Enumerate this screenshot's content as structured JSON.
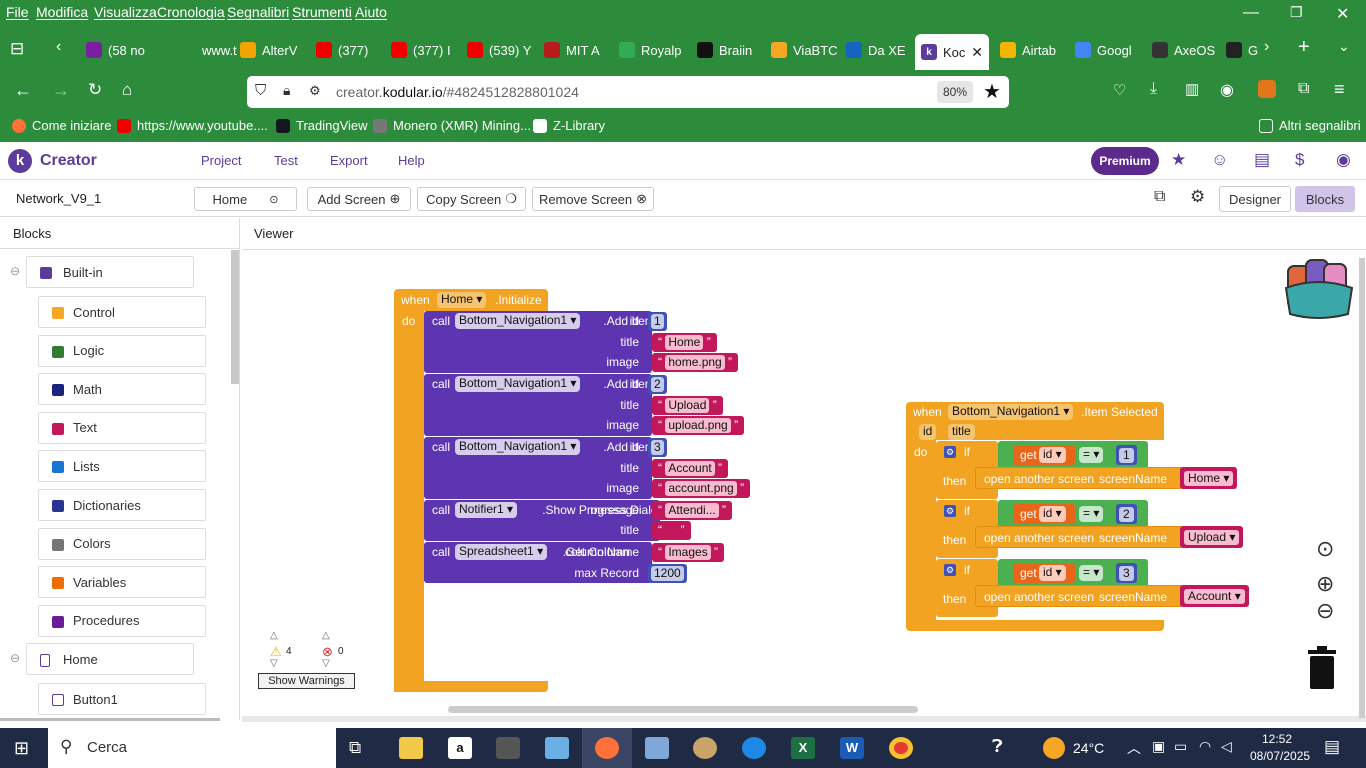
{
  "menu": [
    "File",
    "Modifica",
    "Visualizza",
    "Cronologia",
    "Segnalibri",
    "Strumenti",
    "Aiuto"
  ],
  "tabs": [
    {
      "label": "(58 no",
      "icon": "mail-icon",
      "color": "#7b1fa2"
    },
    {
      "label": "www.t",
      "icon": "globe-icon",
      "color": "#2d8c3c"
    },
    {
      "label": "AlterV",
      "icon": "amazon-icon",
      "color": "#f0a500"
    },
    {
      "label": "(377)",
      "icon": "youtube-icon",
      "color": "#e00"
    },
    {
      "label": "(377) I",
      "icon": "youtube-icon",
      "color": "#e00"
    },
    {
      "label": "(539) Y",
      "icon": "youtube-icon",
      "color": "#e00"
    },
    {
      "label": "MIT A",
      "icon": "mit-icon",
      "color": "#b71c1c"
    },
    {
      "label": "Royalp",
      "icon": "royal-icon",
      "color": "#3a5"
    },
    {
      "label": "Braiin",
      "icon": "braiins-icon",
      "color": "#111"
    },
    {
      "label": "ViaBTC",
      "icon": "viabtc-icon",
      "color": "#f5a623"
    },
    {
      "label": "Da XE",
      "icon": "xe-icon",
      "color": "#1565c0"
    },
    {
      "label": "Koc",
      "icon": "kodular-icon",
      "color": "#5c3c9b"
    },
    {
      "label": "Airtab",
      "icon": "airtable-icon",
      "color": "#f4b400"
    },
    {
      "label": "Googl",
      "icon": "google-icon",
      "color": "#4285f4"
    },
    {
      "label": "AxeOS",
      "icon": "axeos-icon",
      "color": "#333"
    },
    {
      "label": "G",
      "icon": "github-icon",
      "color": "#222"
    }
  ],
  "url": {
    "prefix": "creator.",
    "domain": "kodular.io",
    "path": "/#4824512828801024",
    "zoom": "80%"
  },
  "bookmarks": [
    {
      "label": "Come iniziare",
      "color": "#ff7139"
    },
    {
      "label": "https://www.youtube....",
      "color": "#e00"
    },
    {
      "label": "TradingView",
      "color": "#131722"
    },
    {
      "label": "Monero (XMR) Mining...",
      "color": "#555"
    },
    {
      "label": "Z-Library",
      "color": "#fff"
    },
    {
      "label": "Altri segnalibri",
      "color": "#fff"
    }
  ],
  "app": {
    "brand": "Creator",
    "nav": [
      "Project",
      "Test",
      "Export",
      "Help"
    ],
    "premium": "Premium"
  },
  "toolbar": {
    "project": "Network_V9_1",
    "screen": "Home",
    "add": "Add Screen",
    "copy": "Copy Screen",
    "remove": "Remove Screen",
    "designer": "Designer",
    "blocks": "Blocks"
  },
  "panel": {
    "title": "Blocks",
    "viewer": "Viewer"
  },
  "builtin": {
    "label": "Built-in",
    "items": [
      {
        "label": "Control",
        "color": "#f5a623"
      },
      {
        "label": "Logic",
        "color": "#2e7d32"
      },
      {
        "label": "Math",
        "color": "#1a237e"
      },
      {
        "label": "Text",
        "color": "#c2185b"
      },
      {
        "label": "Lists",
        "color": "#1976d2"
      },
      {
        "label": "Dictionaries",
        "color": "#283593"
      },
      {
        "label": "Colors",
        "color": "#757575"
      },
      {
        "label": "Variables",
        "color": "#ef6c00"
      },
      {
        "label": "Procedures",
        "color": "#6a1b9a"
      }
    ]
  },
  "components": {
    "screen": "Home",
    "first": "Button1"
  },
  "warnings": {
    "count": "4",
    "errors": "0",
    "button": "Show Warnings"
  },
  "init_block": {
    "when": "when",
    "screen": "Home",
    "event": ".Initialize",
    "do": "do",
    "calls": [
      {
        "call": "call",
        "component": "Bottom_Navigation1",
        "method": ".Add Item",
        "args": [
          {
            "name": "id",
            "value": "1"
          },
          {
            "name": "title",
            "value": "Home"
          },
          {
            "name": "image",
            "value": "home.png"
          }
        ]
      },
      {
        "call": "call",
        "component": "Bottom_Navigation1",
        "method": ".Add Item",
        "args": [
          {
            "name": "id",
            "value": "2"
          },
          {
            "name": "title",
            "value": "Upload"
          },
          {
            "name": "image",
            "value": "upload.png"
          }
        ]
      },
      {
        "call": "call",
        "component": "Bottom_Navigation1",
        "method": ".Add Item",
        "args": [
          {
            "name": "id",
            "value": "3"
          },
          {
            "name": "title",
            "value": "Account"
          },
          {
            "name": "image",
            "value": "account.png"
          }
        ]
      },
      {
        "call": "call",
        "component": "Notifier1",
        "method": ".Show Progress Dialog",
        "args": [
          {
            "name": "message",
            "value": "Attendi..."
          },
          {
            "name": "title",
            "value": ""
          }
        ]
      },
      {
        "call": "call",
        "component": "Spreadsheet1",
        "method": ".Get Column",
        "args": [
          {
            "name": "column Name",
            "value": "Images"
          },
          {
            "name": "max Record",
            "value": "1200"
          }
        ]
      }
    ]
  },
  "select_block": {
    "when": "when",
    "component": "Bottom_Navigation1",
    "event": ".Item Selected",
    "params": [
      "id",
      "title"
    ],
    "do": "do",
    "branches": [
      {
        "if": "if",
        "get": "get",
        "var": "id",
        "op": "=",
        "num": "1",
        "then": "then",
        "action": "open another screen",
        "param": "screenName",
        "screen": "Home"
      },
      {
        "if": "if",
        "get": "get",
        "var": "id",
        "op": "=",
        "num": "2",
        "then": "then",
        "action": "open another screen",
        "param": "screenName",
        "screen": "Upload"
      },
      {
        "if": "if",
        "get": "get",
        "var": "id",
        "op": "=",
        "num": "3",
        "then": "then",
        "action": "open another screen",
        "param": "screenName",
        "screen": "Account"
      }
    ]
  },
  "taskbar": {
    "search": "Cerca",
    "temp": "24°C",
    "time": "12:52",
    "date": "08/07/2025"
  }
}
